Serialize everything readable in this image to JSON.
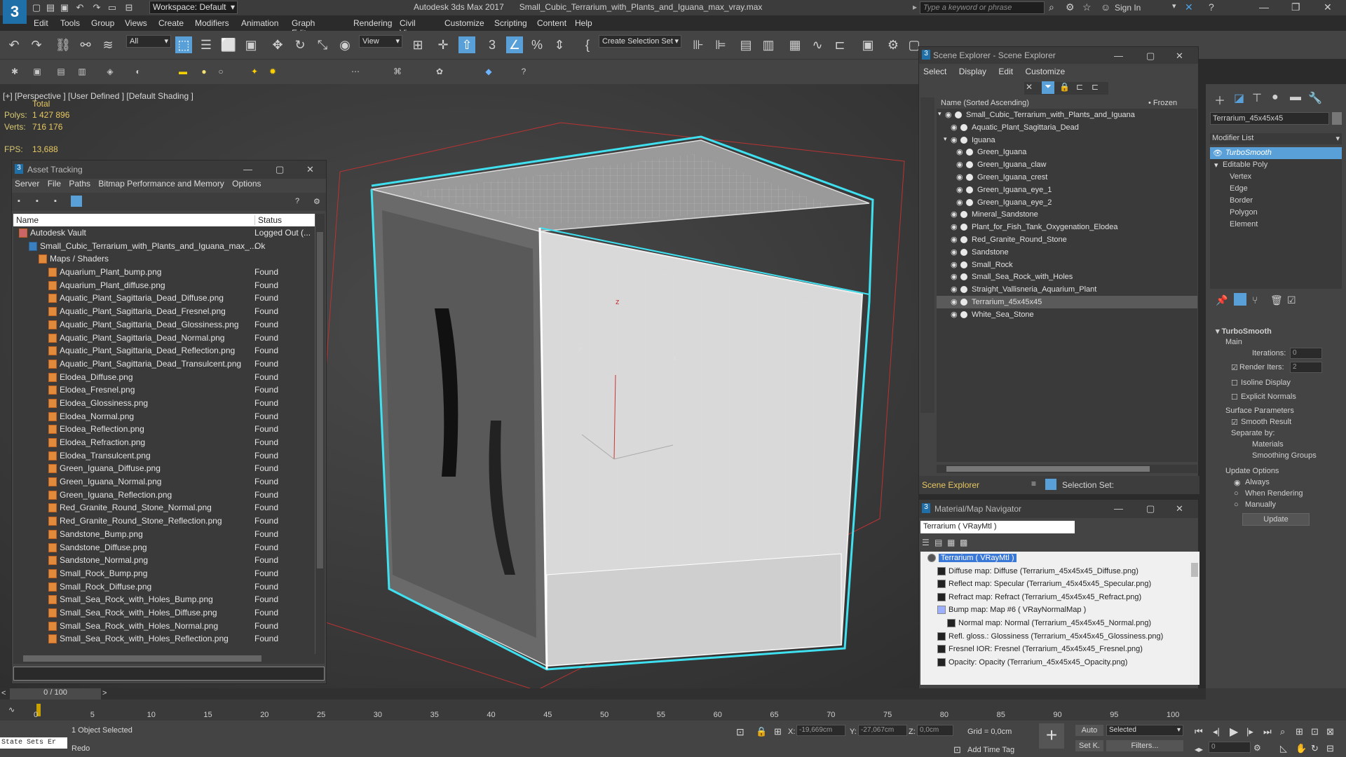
{
  "app": {
    "workspace": "Workspace: Default",
    "title": "Autodesk 3ds Max 2017",
    "file": "Small_Cubic_Terrarium_with_Plants_and_Iguana_max_vray.max",
    "search_placeholder": "Type a keyword or phrase",
    "signin": "Sign In"
  },
  "menu": [
    "Edit",
    "Tools",
    "Group",
    "Views",
    "Create",
    "Modifiers",
    "Animation",
    "Graph Editors",
    "Rendering",
    "Civil View",
    "Customize",
    "Scripting",
    "Content",
    "Help"
  ],
  "toolbar": {
    "filter": "All",
    "view": "View",
    "selset": "Create Selection Set"
  },
  "viewport": {
    "label": "[+] [Perspective ] [User Defined ] [Default Shading ]",
    "total": "Total",
    "polys_label": "Polys:",
    "polys": "1 427 896",
    "verts_label": "Verts:",
    "verts": "716 176",
    "fps_label": "FPS:",
    "fps": "13,688",
    "axis_x": "x",
    "axis_y": "y",
    "axis_z": "z"
  },
  "asset": {
    "title": "Asset Tracking",
    "menu": [
      "Server",
      "File",
      "Paths",
      "Bitmap Performance and Memory",
      "Options"
    ],
    "col_name": "Name",
    "col_status": "Status",
    "rows": [
      {
        "name": "Autodesk Vault",
        "status": "Logged Out (...",
        "indent": 0,
        "icon": "vault"
      },
      {
        "name": "Small_Cubic_Terrarium_with_Plants_and_Iguana_max_...",
        "status": "Ok",
        "indent": 1,
        "icon": "max"
      },
      {
        "name": "Maps / Shaders",
        "status": "",
        "indent": 2,
        "icon": "folder"
      },
      {
        "name": "Aquarium_Plant_bump.png",
        "status": "Found",
        "indent": 3,
        "icon": "file"
      },
      {
        "name": "Aquarium_Plant_diffuse.png",
        "status": "Found",
        "indent": 3,
        "icon": "file"
      },
      {
        "name": "Aquatic_Plant_Sagittaria_Dead_Diffuse.png",
        "status": "Found",
        "indent": 3,
        "icon": "file"
      },
      {
        "name": "Aquatic_Plant_Sagittaria_Dead_Fresnel.png",
        "status": "Found",
        "indent": 3,
        "icon": "file"
      },
      {
        "name": "Aquatic_Plant_Sagittaria_Dead_Glossiness.png",
        "status": "Found",
        "indent": 3,
        "icon": "file"
      },
      {
        "name": "Aquatic_Plant_Sagittaria_Dead_Normal.png",
        "status": "Found",
        "indent": 3,
        "icon": "file"
      },
      {
        "name": "Aquatic_Plant_Sagittaria_Dead_Reflection.png",
        "status": "Found",
        "indent": 3,
        "icon": "file"
      },
      {
        "name": "Aquatic_Plant_Sagittaria_Dead_Transulcent.png",
        "status": "Found",
        "indent": 3,
        "icon": "file"
      },
      {
        "name": "Elodea_Diffuse.png",
        "status": "Found",
        "indent": 3,
        "icon": "file"
      },
      {
        "name": "Elodea_Fresnel.png",
        "status": "Found",
        "indent": 3,
        "icon": "file"
      },
      {
        "name": "Elodea_Glossiness.png",
        "status": "Found",
        "indent": 3,
        "icon": "file"
      },
      {
        "name": "Elodea_Normal.png",
        "status": "Found",
        "indent": 3,
        "icon": "file"
      },
      {
        "name": "Elodea_Reflection.png",
        "status": "Found",
        "indent": 3,
        "icon": "file"
      },
      {
        "name": "Elodea_Refraction.png",
        "status": "Found",
        "indent": 3,
        "icon": "file"
      },
      {
        "name": "Elodea_Transulcent.png",
        "status": "Found",
        "indent": 3,
        "icon": "file"
      },
      {
        "name": "Green_Iguana_Diffuse.png",
        "status": "Found",
        "indent": 3,
        "icon": "file"
      },
      {
        "name": "Green_Iguana_Normal.png",
        "status": "Found",
        "indent": 3,
        "icon": "file"
      },
      {
        "name": "Green_Iguana_Reflection.png",
        "status": "Found",
        "indent": 3,
        "icon": "file"
      },
      {
        "name": "Red_Granite_Round_Stone_Normal.png",
        "status": "Found",
        "indent": 3,
        "icon": "file"
      },
      {
        "name": "Red_Granite_Round_Stone_Reflection.png",
        "status": "Found",
        "indent": 3,
        "icon": "file"
      },
      {
        "name": "Sandstone_Bump.png",
        "status": "Found",
        "indent": 3,
        "icon": "file"
      },
      {
        "name": "Sandstone_Diffuse.png",
        "status": "Found",
        "indent": 3,
        "icon": "file"
      },
      {
        "name": "Sandstone_Normal.png",
        "status": "Found",
        "indent": 3,
        "icon": "file"
      },
      {
        "name": "Small_Rock_Bump.png",
        "status": "Found",
        "indent": 3,
        "icon": "file"
      },
      {
        "name": "Small_Rock_Diffuse.png",
        "status": "Found",
        "indent": 3,
        "icon": "file"
      },
      {
        "name": "Small_Sea_Rock_with_Holes_Bump.png",
        "status": "Found",
        "indent": 3,
        "icon": "file"
      },
      {
        "name": "Small_Sea_Rock_with_Holes_Diffuse.png",
        "status": "Found",
        "indent": 3,
        "icon": "file"
      },
      {
        "name": "Small_Sea_Rock_with_Holes_Normal.png",
        "status": "Found",
        "indent": 3,
        "icon": "file"
      },
      {
        "name": "Small_Sea_Rock_with_Holes_Reflection.png",
        "status": "Found",
        "indent": 3,
        "icon": "file"
      }
    ]
  },
  "scene": {
    "title": "Scene Explorer - Scene Explorer",
    "menu": [
      "Select",
      "Display",
      "Edit",
      "Customize"
    ],
    "col_name": "Name (Sorted Ascending)",
    "col_frozen": "• Frozen",
    "footer": "Scene Explorer",
    "selset": "Selection Set:",
    "rows": [
      {
        "name": "Small_Cubic_Terrarium_with_Plants_and_Iguana",
        "indent": 0,
        "selected": false
      },
      {
        "name": "Aquatic_Plant_Sagittaria_Dead",
        "indent": 1,
        "selected": false
      },
      {
        "name": "Iguana",
        "indent": 1,
        "selected": false
      },
      {
        "name": "Green_Iguana",
        "indent": 2,
        "selected": false
      },
      {
        "name": "Green_Iguana_claw",
        "indent": 2,
        "selected": false
      },
      {
        "name": "Green_Iguana_crest",
        "indent": 2,
        "selected": false
      },
      {
        "name": "Green_Iguana_eye_1",
        "indent": 2,
        "selected": false
      },
      {
        "name": "Green_Iguana_eye_2",
        "indent": 2,
        "selected": false
      },
      {
        "name": "Mineral_Sandstone",
        "indent": 1,
        "selected": false
      },
      {
        "name": "Plant_for_Fish_Tank_Oxygenation_Elodea",
        "indent": 1,
        "selected": false
      },
      {
        "name": "Red_Granite_Round_Stone",
        "indent": 1,
        "selected": false
      },
      {
        "name": "Sandstone",
        "indent": 1,
        "selected": false
      },
      {
        "name": "Small_Rock",
        "indent": 1,
        "selected": false
      },
      {
        "name": "Small_Sea_Rock_with_Holes",
        "indent": 1,
        "selected": false
      },
      {
        "name": "Straight_Vallisneria_Aquarium_Plant",
        "indent": 1,
        "selected": false
      },
      {
        "name": "Terrarium_45x45x45",
        "indent": 1,
        "selected": true
      },
      {
        "name": "White_Sea_Stone",
        "indent": 1,
        "selected": false
      }
    ]
  },
  "material": {
    "title": "Material/Map Navigator",
    "field": "Terrarium  ( VRayMtl )",
    "rows": [
      {
        "label": "Terrarium  ( VRayMtl )",
        "indent": 0,
        "root": true
      },
      {
        "label": "Diffuse map: Diffuse (Terrarium_45x45x45_Diffuse.png)",
        "indent": 1
      },
      {
        "label": "Reflect map: Specular (Terrarium_45x45x45_Specular.png)",
        "indent": 1
      },
      {
        "label": "Refract map: Refract (Terrarium_45x45x45_Refract.png)",
        "indent": 1
      },
      {
        "label": "Bump map: Map #6  ( VRayNormalMap )",
        "indent": 1
      },
      {
        "label": "Normal map: Normal (Terrarium_45x45x45_Normal.png)",
        "indent": 2
      },
      {
        "label": "Refl. gloss.: Glossiness (Terrarium_45x45x45_Glossiness.png)",
        "indent": 1
      },
      {
        "label": "Fresnel IOR: Fresnel (Terrarium_45x45x45_Fresnel.png)",
        "indent": 1
      },
      {
        "label": "Opacity: Opacity (Terrarium_45x45x45_Opacity.png)",
        "indent": 1
      }
    ]
  },
  "cmd": {
    "object": "Terrarium_45x45x45",
    "modlist": "Modifier List",
    "stack": [
      "TurboSmooth",
      "Editable Poly",
      "Vertex",
      "Edge",
      "Border",
      "Polygon",
      "Element"
    ],
    "rollout": "TurboSmooth",
    "main": "Main",
    "iter_label": "Iterations:",
    "iter": "0",
    "render_label": "Render Iters:",
    "render": "2",
    "isoline": "Isoline Display",
    "explicit": "Explicit Normals",
    "surf": "Surface Parameters",
    "smooth": "Smooth Result",
    "sepby": "Separate by:",
    "materials": "Materials",
    "smoothing": "Smoothing Groups",
    "update_opts": "Update Options",
    "always": "Always",
    "when": "When Rendering",
    "manually": "Manually",
    "update_btn": "Update"
  },
  "time": {
    "frame": "0 / 100",
    "ticks": [
      "0",
      "5",
      "10",
      "15",
      "20",
      "25",
      "30",
      "35",
      "40",
      "45",
      "50",
      "55",
      "60",
      "65",
      "70",
      "75",
      "80",
      "85",
      "90",
      "95",
      "100"
    ]
  },
  "status": {
    "selected": "1 Object Selected",
    "redo": "Redo",
    "state": "State Sets Er",
    "x_label": "X:",
    "x": "-19,669cm",
    "y_label": "Y:",
    "y": "-27,067cm",
    "z_label": "Z:",
    "z": "0,0cm",
    "grid": "Grid = 0,0cm",
    "auto": "Auto",
    "selected_dd": "Selected",
    "setk": "Set K.",
    "filters": "Filters...",
    "addtime": "Add Time Tag",
    "frame_field": "0"
  }
}
